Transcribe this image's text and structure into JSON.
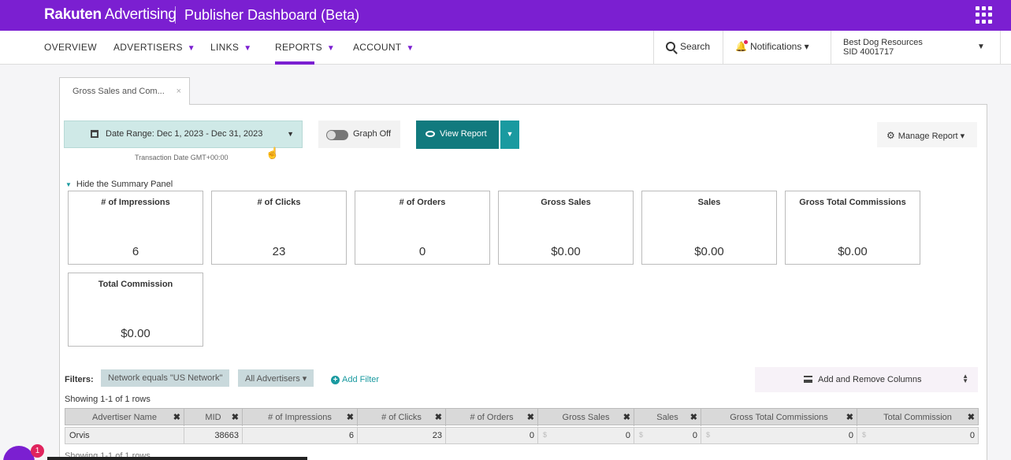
{
  "topbar": {
    "brand_bold": "Rakuten",
    "brand_rest": " Advertising",
    "app_title": "Publisher Dashboard (Beta)"
  },
  "nav": {
    "items": [
      {
        "label": "OVERVIEW",
        "caret": ""
      },
      {
        "label": "ADVERTISERS",
        "caret": "▼"
      },
      {
        "label": "LINKS",
        "caret": "▼"
      },
      {
        "label": "REPORTS",
        "caret": "▼"
      },
      {
        "label": "ACCOUNT",
        "caret": "▼"
      }
    ],
    "active": "REPORTS",
    "search_label": "Search",
    "notifications_label": "Notifications ▾",
    "account_name": "Best Dog Resources",
    "account_sid": "SID 4001717"
  },
  "report_tab": {
    "label": "Gross Sales and Com...",
    "close": "×"
  },
  "controls": {
    "date_range": "Date Range: Dec 1, 2023 - Dec 31, 2023",
    "tz_note": "Transaction Date GMT+00:00",
    "graph_toggle": "Graph Off",
    "view_report": "View Report",
    "manage_report": "Manage Report ▾"
  },
  "summary": {
    "toggle_label": "Hide the Summary Panel",
    "cards": [
      {
        "title": "# of Impressions",
        "value": "6"
      },
      {
        "title": "# of Clicks",
        "value": "23"
      },
      {
        "title": "# of Orders",
        "value": "0"
      },
      {
        "title": "Gross Sales",
        "value": "$0.00"
      },
      {
        "title": "Sales",
        "value": "$0.00"
      },
      {
        "title": "Gross Total Commissions",
        "value": "$0.00"
      },
      {
        "title": "Total Commission",
        "value": "$0.00"
      }
    ]
  },
  "filters": {
    "label": "Filters:",
    "chips": [
      "Network equals \"US Network\"",
      "All Advertisers ▾"
    ],
    "add_filter": "Add Filter",
    "columns_button": "Add and Remove Columns"
  },
  "table": {
    "showing": "Showing 1-1 of 1 rows",
    "columns": [
      "Advertiser Name",
      "MID",
      "# of Impressions",
      "# of Clicks",
      "# of Orders",
      "Gross Sales",
      "Sales",
      "Gross Total Commissions",
      "Total Commission"
    ],
    "rows": [
      {
        "advertiser": "Orvis",
        "mid": "38663",
        "impressions": "6",
        "clicks": "23",
        "orders": "0",
        "gross_sales": "0",
        "sales": "0",
        "gross_total_commissions": "0",
        "total_commission": "0"
      }
    ],
    "currency_prefix": "$"
  },
  "chat": {
    "badge": "1"
  },
  "colors": {
    "brand": "#7b1fd1",
    "teal": "#117a7e"
  }
}
